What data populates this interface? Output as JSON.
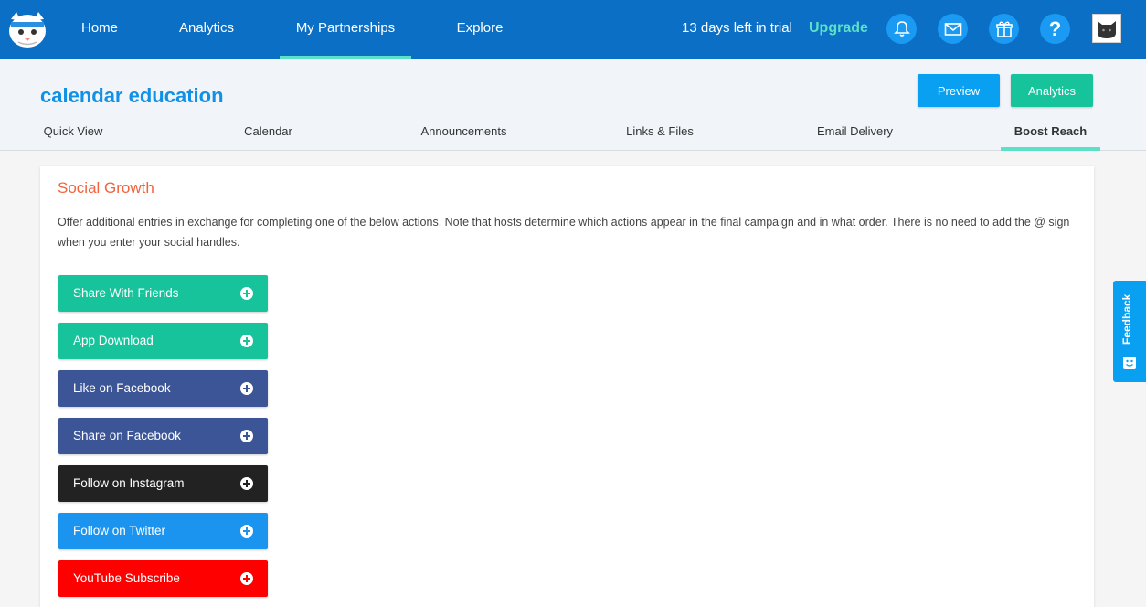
{
  "topnav": {
    "links": [
      "Home",
      "Analytics",
      "My Partnerships",
      "Explore"
    ],
    "active": "My Partnerships",
    "trial_text": "13 days left in trial",
    "upgrade_label": "Upgrade",
    "icons": [
      "bell-icon",
      "mail-icon",
      "gift-icon",
      "help-icon"
    ],
    "help_glyph": "?"
  },
  "subheader": {
    "title": "calendar education",
    "preview_label": "Preview",
    "analytics_label": "Analytics",
    "tabs": [
      "Quick View",
      "Calendar",
      "Announcements",
      "Links & Files",
      "Email Delivery",
      "Boost Reach"
    ],
    "active_tab": "Boost Reach"
  },
  "social_growth": {
    "title": "Social Growth",
    "description": "Offer additional entries in exchange for completing one of the below actions. Note that hosts determine which actions appear in the final campaign and in what order. There is no need to add the @ sign when you enter your social handles.",
    "actions": [
      {
        "label": "Share With Friends",
        "color": "#16c39b"
      },
      {
        "label": "App Download",
        "color": "#16c39b"
      },
      {
        "label": "Like on Facebook",
        "color": "#3b5596"
      },
      {
        "label": "Share on Facebook",
        "color": "#3b5596"
      },
      {
        "label": "Follow on Instagram",
        "color": "#222222"
      },
      {
        "label": "Follow on Twitter",
        "color": "#1b94f0"
      },
      {
        "label": "YouTube Subscribe",
        "color": "#ff0000"
      }
    ]
  },
  "feedback": {
    "label": "Feedback"
  },
  "colors": {
    "nav_bg": "#0b6fc6",
    "accent": "#5ce0c8",
    "title_blue": "#1191e6",
    "section_orange": "#f0633c"
  }
}
